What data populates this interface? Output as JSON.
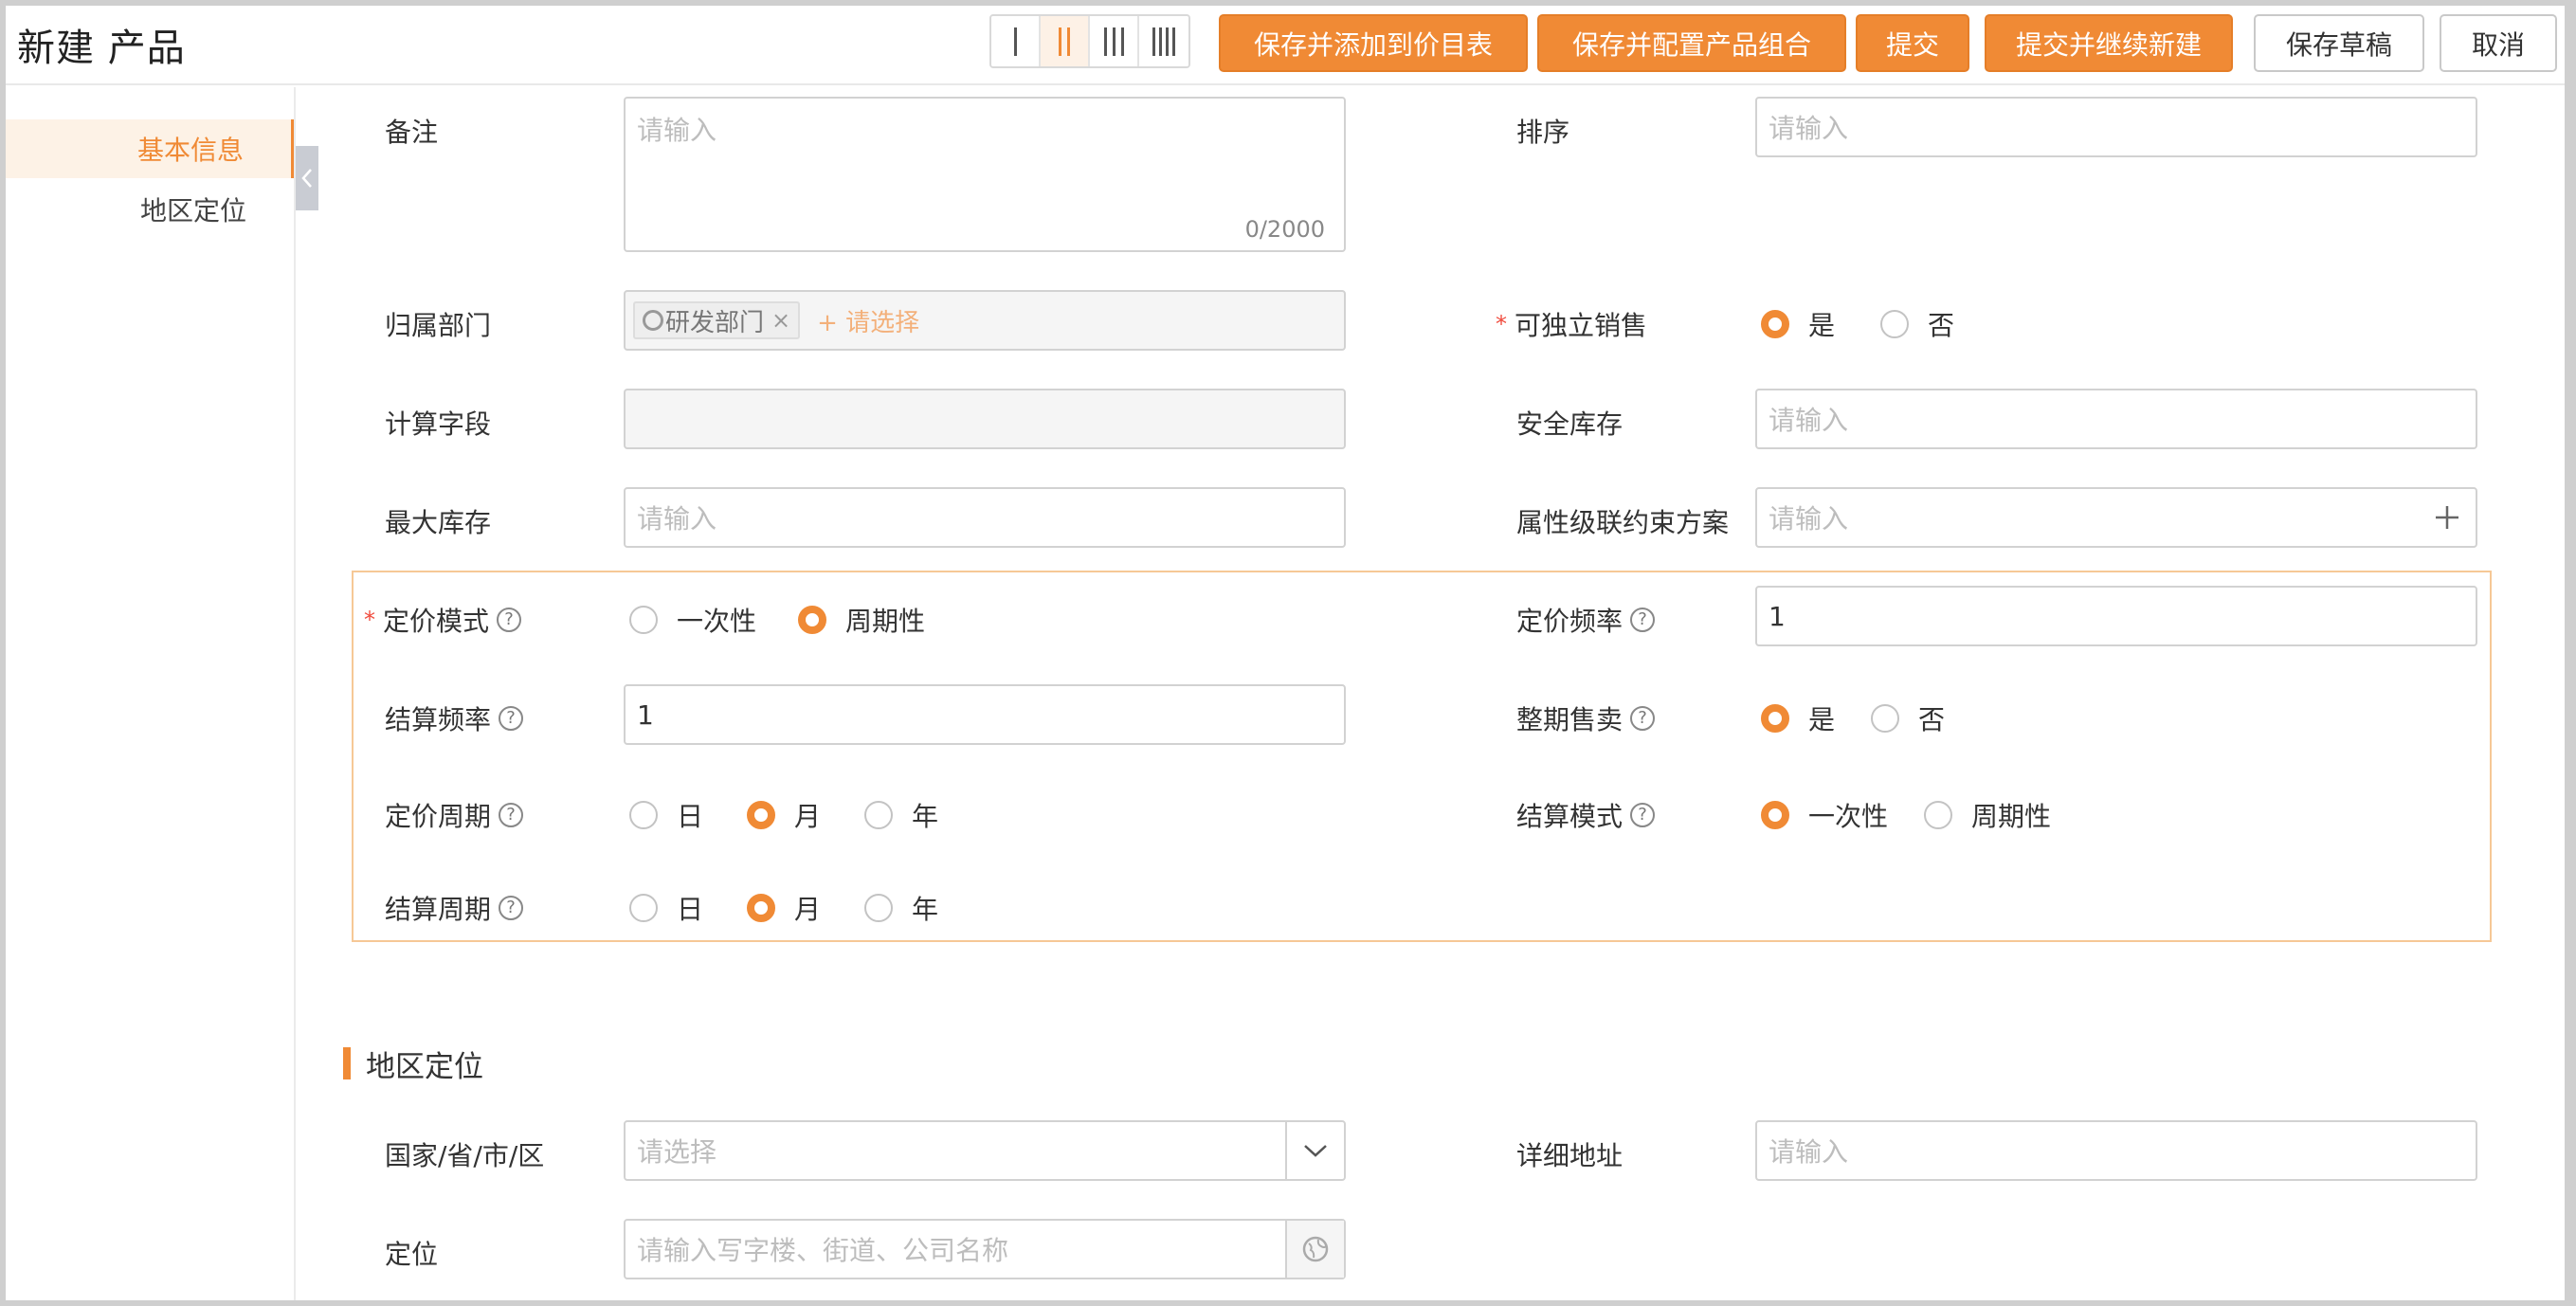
{
  "header": {
    "title": "新建 产品",
    "buttons": {
      "save_add_pricelist": "保存并添加到价目表",
      "save_config_bundle": "保存并配置产品组合",
      "submit": "提交",
      "submit_continue": "提交并继续新建",
      "save_draft": "保存草稿",
      "cancel": "取消"
    }
  },
  "sidebar": {
    "items": [
      {
        "label": "基本信息",
        "active": true
      },
      {
        "label": "地区定位",
        "active": false
      }
    ]
  },
  "form": {
    "remark": {
      "label": "备注",
      "placeholder": "请输入",
      "counter": "0/2000"
    },
    "sort": {
      "label": "排序",
      "placeholder": "请输入"
    },
    "department": {
      "label": "归属部门",
      "tag": "研发部门",
      "add_text": "+ 请选择"
    },
    "independent_sale": {
      "label": "可独立销售",
      "options": [
        "是",
        "否"
      ],
      "selected": "是"
    },
    "calc_field": {
      "label": "计算字段"
    },
    "safety_stock": {
      "label": "安全库存",
      "placeholder": "请输入"
    },
    "max_stock": {
      "label": "最大库存",
      "placeholder": "请输入"
    },
    "attr_constraint": {
      "label": "属性级联约束方案",
      "placeholder": "请输入"
    },
    "pricing_mode": {
      "label": "定价模式",
      "options": [
        "一次性",
        "周期性"
      ],
      "selected": "周期性"
    },
    "pricing_freq": {
      "label": "定价频率",
      "value": "1"
    },
    "settle_freq": {
      "label": "结算频率",
      "value": "1"
    },
    "whole_period": {
      "label": "整期售卖",
      "options": [
        "是",
        "否"
      ],
      "selected": "是"
    },
    "pricing_period": {
      "label": "定价周期",
      "options": [
        "日",
        "月",
        "年"
      ],
      "selected": "月"
    },
    "settle_mode": {
      "label": "结算模式",
      "options": [
        "一次性",
        "周期性"
      ],
      "selected": "一次性"
    },
    "settle_period": {
      "label": "结算周期",
      "options": [
        "日",
        "月",
        "年"
      ],
      "selected": "月"
    }
  },
  "region": {
    "section_title": "地区定位",
    "country": {
      "label": "国家/省/市/区",
      "placeholder": "请选择"
    },
    "address": {
      "label": "详细地址",
      "placeholder": "请输入"
    },
    "location": {
      "label": "定位",
      "placeholder": "请输入写字楼、街道、公司名称"
    }
  },
  "colors": {
    "accent": "#f08a35",
    "required": "#f04b3d"
  }
}
